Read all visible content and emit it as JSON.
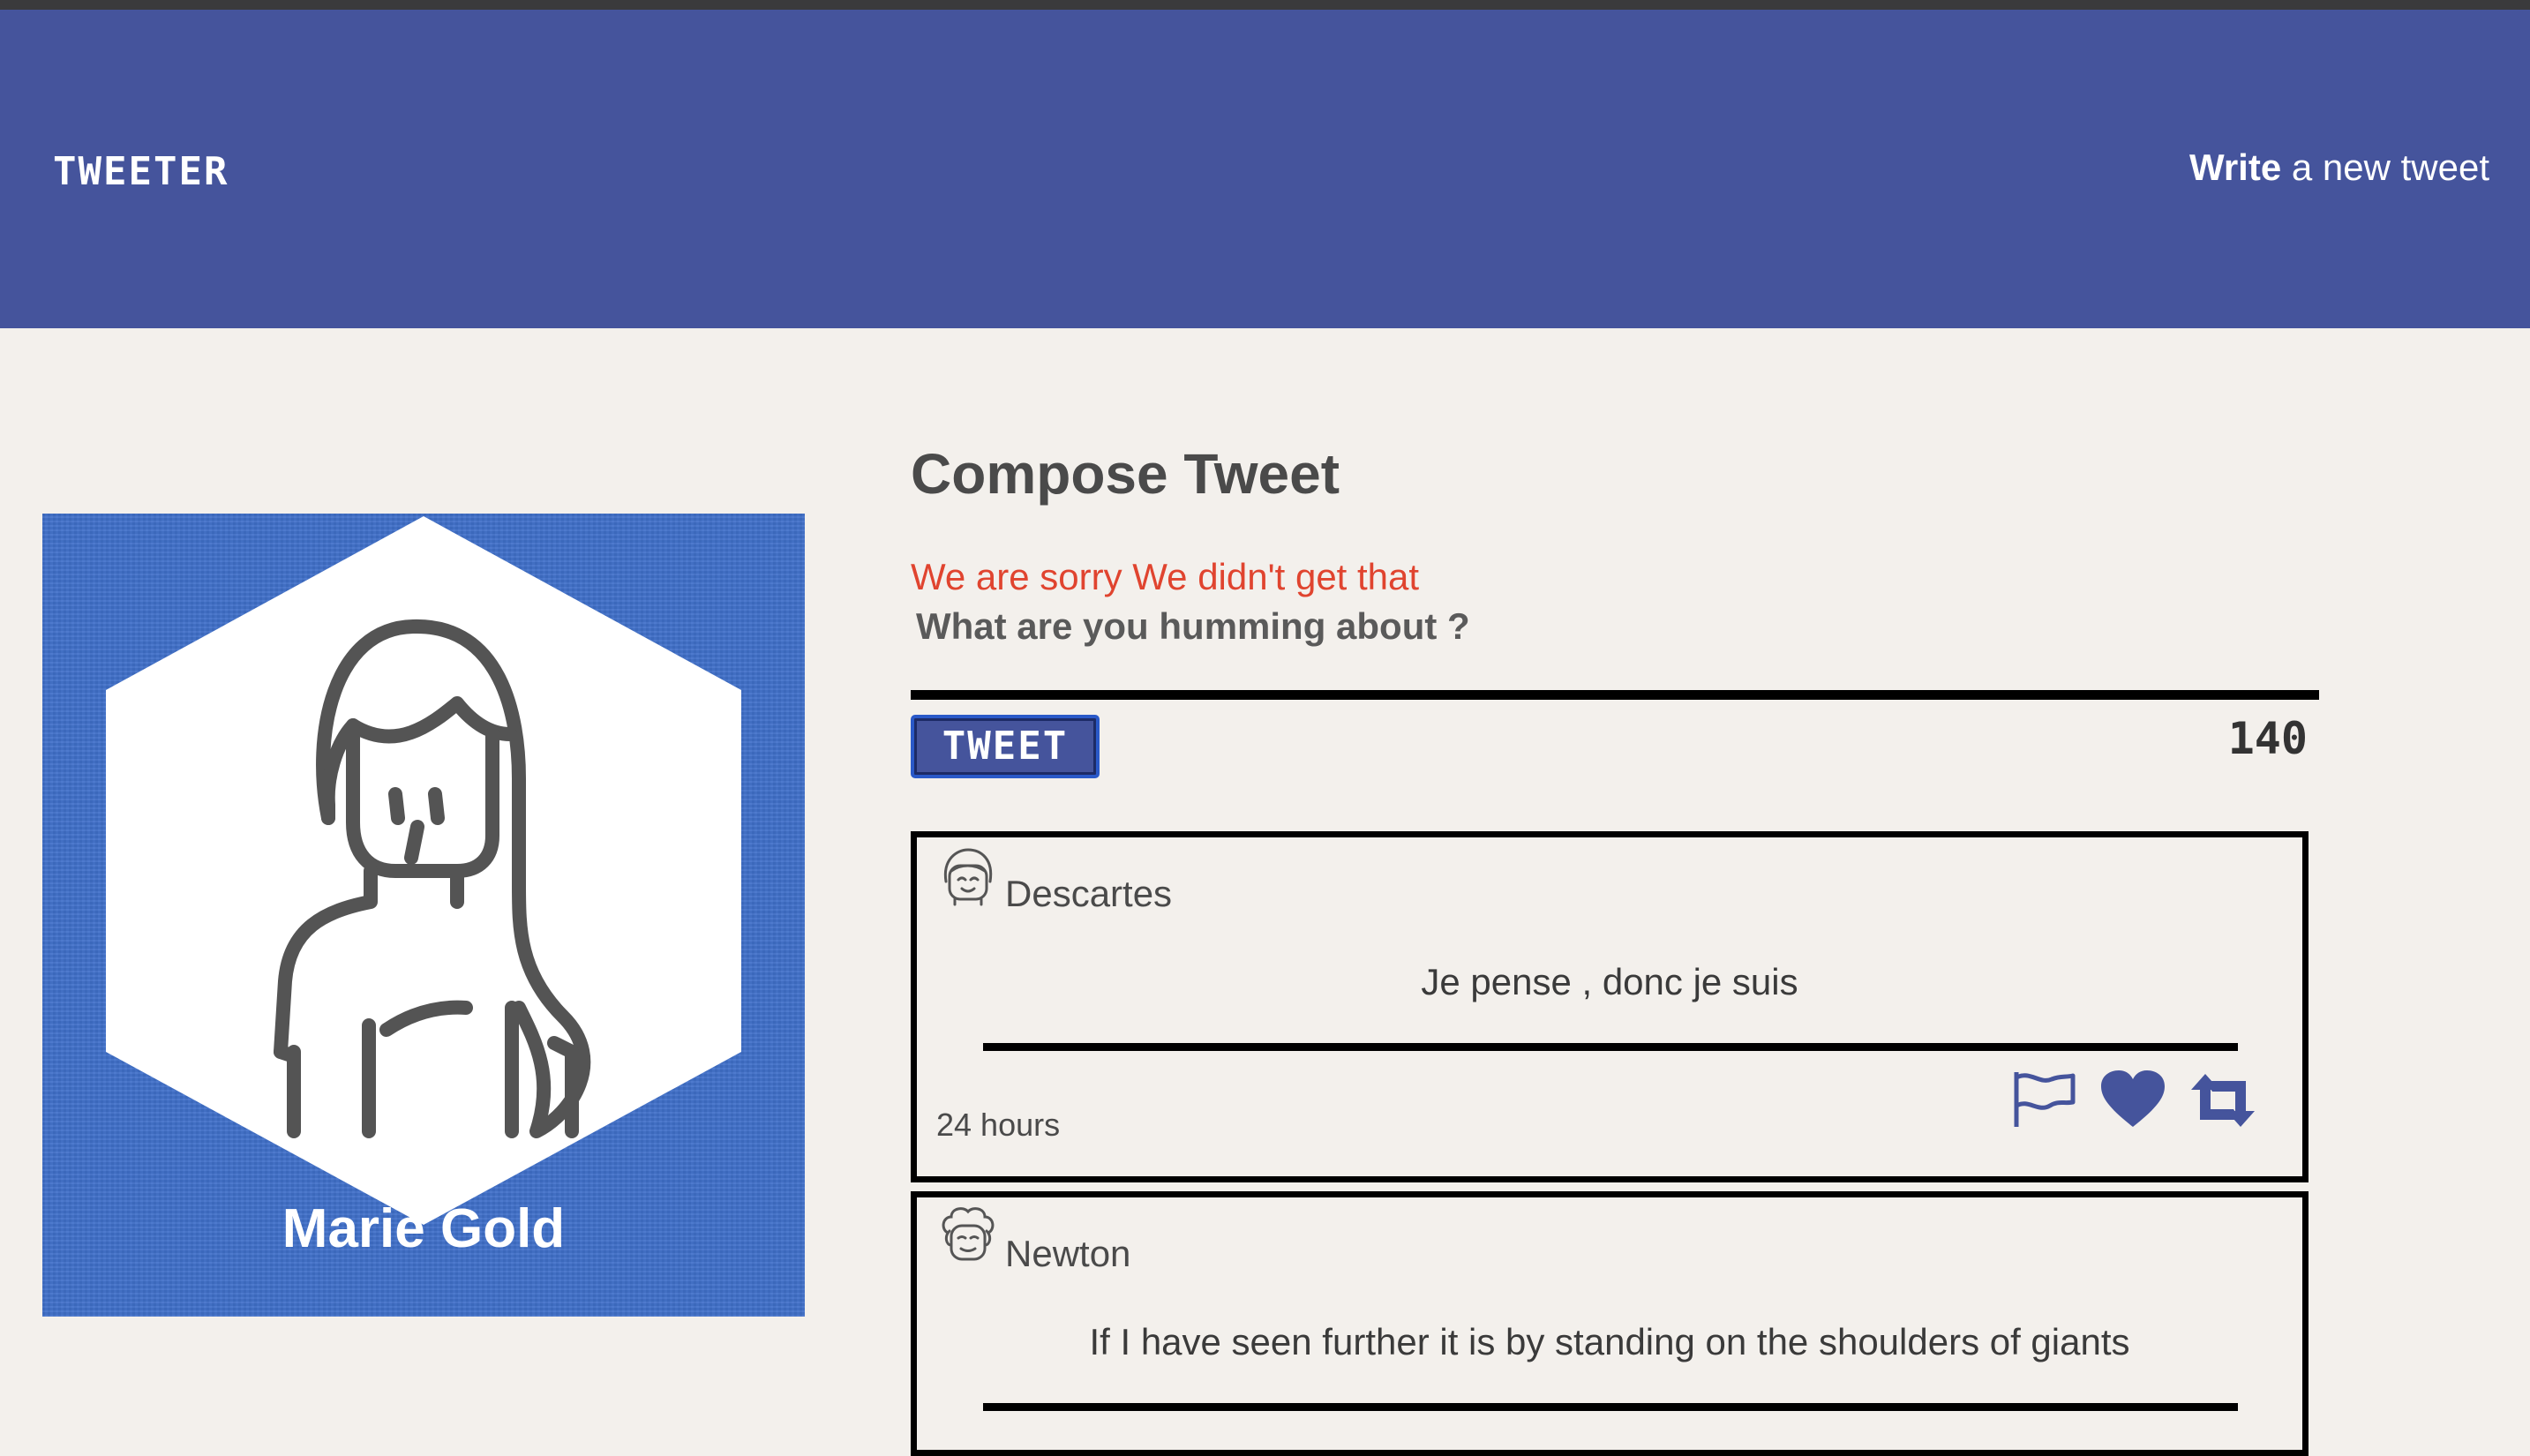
{
  "nav": {
    "brand": "TWEETER",
    "link_bold": "Write",
    "link_rest": " a new tweet"
  },
  "profile": {
    "name": "Marie Gold",
    "icon": "woman-avatar-icon"
  },
  "compose": {
    "title": "Compose Tweet",
    "error": "We are sorry We didn't get that",
    "prompt": "What are you humming about ?",
    "button_label": "TWEET",
    "counter": "140"
  },
  "tweets": [
    {
      "author": "Descartes",
      "content": "Je pense , donc je suis",
      "time": "24 hours",
      "avatar": "smiling-face-avatar-icon",
      "actions": [
        "flag-icon",
        "heart-icon",
        "retweet-icon"
      ]
    },
    {
      "author": "Newton",
      "content": "If I have seen further it is by standing on the shoulders of giants",
      "avatar": "curly-hair-face-avatar-icon"
    }
  ],
  "colors": {
    "navbar": "#45549c",
    "background": "#f3f0ec",
    "error": "#e0442f",
    "profile_bg": "#3f6fc9"
  }
}
